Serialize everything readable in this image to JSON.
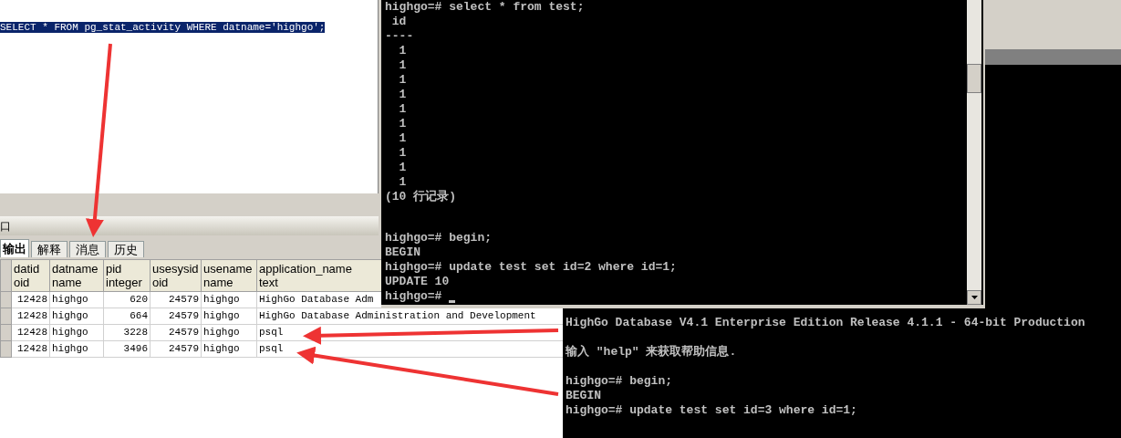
{
  "query_editor": {
    "sql": "SELECT * FROM pg_stat_activity WHERE datname='highgo';",
    "selected": true
  },
  "output_panel": {
    "title": "口",
    "tabs": [
      {
        "label": "输出",
        "selected": true
      },
      {
        "label": "解释",
        "selected": false
      },
      {
        "label": "消息",
        "selected": false
      },
      {
        "label": "历史",
        "selected": false
      }
    ],
    "table": {
      "columns": [
        {
          "name": "datid",
          "type": "oid"
        },
        {
          "name": "datname",
          "type": "name"
        },
        {
          "name": "pid",
          "type": "integer"
        },
        {
          "name": "usesysid",
          "type": "oid"
        },
        {
          "name": "usename",
          "type": "name"
        },
        {
          "name": "application_name",
          "type": "text"
        }
      ],
      "rows": [
        [
          "12428",
          "highgo",
          "620",
          "24579",
          "highgo",
          "HighGo Database Adm"
        ],
        [
          "12428",
          "highgo",
          "664",
          "24579",
          "highgo",
          "HighGo Database Administration and Development"
        ],
        [
          "12428",
          "highgo",
          "3228",
          "24579",
          "highgo",
          "psql"
        ],
        [
          "12428",
          "highgo",
          "3496",
          "24579",
          "highgo",
          "psql"
        ]
      ]
    }
  },
  "terminal_1": {
    "blocks": [
      [
        "highgo=# select * from test;",
        " id",
        "----",
        "  1",
        "  1",
        "  1",
        "  1",
        "  1",
        "  1",
        "  1",
        "  1",
        "  1",
        "  1",
        "(10 行记录)"
      ],
      [
        "highgo=# begin;",
        "BEGIN",
        "highgo=# update test set id=2 where id=1;",
        "UPDATE 10",
        "highgo=# "
      ]
    ],
    "cursor": true
  },
  "terminal_2": {
    "blocks": [
      [
        "HighGo Database V4.1 Enterprise Edition Release 4.1.1 - 64-bit Production"
      ],
      [
        "输入 \"help\" 来获取帮助信息."
      ],
      [
        "highgo=# begin;",
        "BEGIN",
        "highgo=# update test set id=3 where id=1;"
      ]
    ]
  }
}
